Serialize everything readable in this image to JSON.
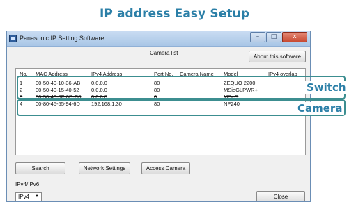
{
  "heading": "IP address Easy Setup",
  "window": {
    "title": "Panasonic IP Setting Software",
    "controls": {
      "minimize": "–",
      "maximize": "□",
      "close": "x"
    }
  },
  "camera_list_label": "Camera list",
  "about_button": "About this software",
  "table": {
    "columns": [
      "No.",
      "MAC Address",
      "IPv4 Address",
      "Port No.",
      "Camera Name",
      "Model",
      "IPv4 overlap"
    ],
    "rows": [
      {
        "no": "1",
        "mac": "00-50-40-10-36-AB",
        "ipv4": "0.0.0.0",
        "port": "80",
        "name": "",
        "model": "ZEQUO 2200",
        "overlap": ""
      },
      {
        "no": "2",
        "mac": "00-50-40-15-40-52",
        "ipv4": "0.0.0.0",
        "port": "80",
        "name": "",
        "model": "MSieGLPWR+",
        "overlap": ""
      },
      {
        "no": "3",
        "mac": "00-50-40-0F-0D-C8",
        "ipv4": "0.0.0.0",
        "port": "0",
        "name": "",
        "model": "MSeG",
        "overlap": ""
      },
      {
        "no": "4",
        "mac": "00-80-45-55-94-6D",
        "ipv4": "192.168.1.30",
        "port": "80",
        "name": "",
        "model": "NP240",
        "overlap": ""
      }
    ]
  },
  "buttons": {
    "search": "Search",
    "network_settings": "Network Settings",
    "access_camera": "Access Camera",
    "close": "Close"
  },
  "ip_version": {
    "label": "IPv4/IPv6",
    "selected": "IPv4"
  },
  "callouts": {
    "switch": "Switch",
    "camera": "Camera"
  },
  "colors": {
    "accent": "#2b7fa7",
    "callout_border": "#3c8e90"
  }
}
